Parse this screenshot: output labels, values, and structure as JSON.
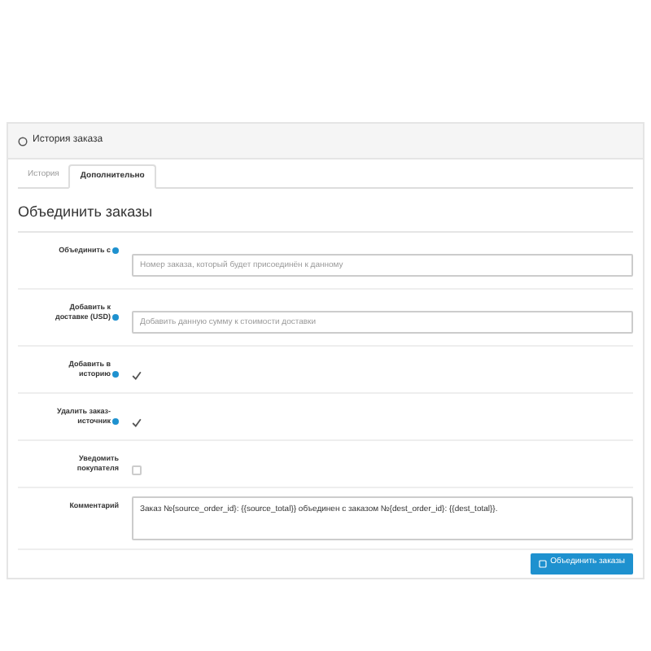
{
  "panel": {
    "title": "История заказа"
  },
  "tabs": [
    {
      "label": "История",
      "selected": false
    },
    {
      "label": "Дополнительно",
      "selected": true
    }
  ],
  "section_title": "Объединить заказы",
  "rows": [
    {
      "kind": "input",
      "label": "Объединить с",
      "help": true,
      "placeholder": "Номер заказа, который будет присоединён к данному"
    },
    {
      "kind": "input",
      "label": "Добавить к доставке (USD)",
      "help": true,
      "placeholder": "Добавить данную сумму к стоимости доставки"
    },
    {
      "kind": "checkbox",
      "label": "Добавить в историю",
      "help": true,
      "checked": true
    },
    {
      "kind": "checkbox",
      "label": "Удалить заказ-источник",
      "help": true,
      "checked": true
    },
    {
      "kind": "checkbox",
      "label": "Уведомить покупателя",
      "help": false,
      "checked": false
    },
    {
      "kind": "textarea",
      "label": "Комментарий",
      "help": false,
      "value": "Заказ №{source_order_id}: {{source_total}} объединен с заказом №{dest_order_id}: {{dest_total}}."
    }
  ],
  "submit": {
    "label": "Объединить заказы"
  }
}
